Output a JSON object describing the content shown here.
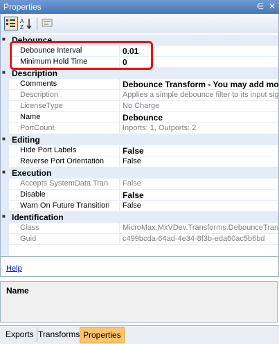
{
  "window": {
    "title": "Properties",
    "pin_icon": "pin-icon",
    "close_icon": "close-icon"
  },
  "toolbar": {
    "categorized_icon": "categorized-icon",
    "alphabetical_icon": "alphabetical-icon",
    "pages_icon": "property-pages-icon"
  },
  "grid": {
    "categories": [
      {
        "name": "Debounce",
        "rows": [
          {
            "name": "Debounce Interval",
            "value": "0.01"
          },
          {
            "name": "Minimum Hold Time",
            "value": "0"
          }
        ]
      },
      {
        "name": "Description",
        "rows": [
          {
            "name": "Comments",
            "value": "Debounce Transform - You may add mo"
          },
          {
            "name": "Description",
            "value": "Applies a simple debounce filter to its input signa"
          },
          {
            "name": "LicenseType",
            "value": "No Charge"
          },
          {
            "name": "Name",
            "value": "Debounce"
          },
          {
            "name": "PortCount",
            "value": "Inports: 1, Outports: 2"
          }
        ]
      },
      {
        "name": "Editing",
        "rows": [
          {
            "name": "Hide Port Labels",
            "value": "False"
          },
          {
            "name": "Reverse Port Orientation",
            "value": "False"
          }
        ]
      },
      {
        "name": "Execution",
        "rows": [
          {
            "name": "Accepts SystemData Transitions",
            "value": "False"
          },
          {
            "name": "Disable",
            "value": "False"
          },
          {
            "name": "Warn On Future Transitions",
            "value": "False"
          }
        ]
      },
      {
        "name": "Identification",
        "rows": [
          {
            "name": "Class",
            "value": "MicroMax.MxVDev.Transforms.DebounceTrans"
          },
          {
            "name": "Guid",
            "value": "c499bcda-64ad-4e34-8f3b-eda60ac5b6bd"
          }
        ]
      }
    ]
  },
  "help": {
    "link": "Help"
  },
  "description_pane": {
    "name": "Name"
  },
  "tabs": [
    "Exports",
    "Transforms",
    "Properties"
  ],
  "colors": {
    "accent": "#4a76b8",
    "active_tab": "#ffc36b",
    "highlight": "#ee1111"
  }
}
